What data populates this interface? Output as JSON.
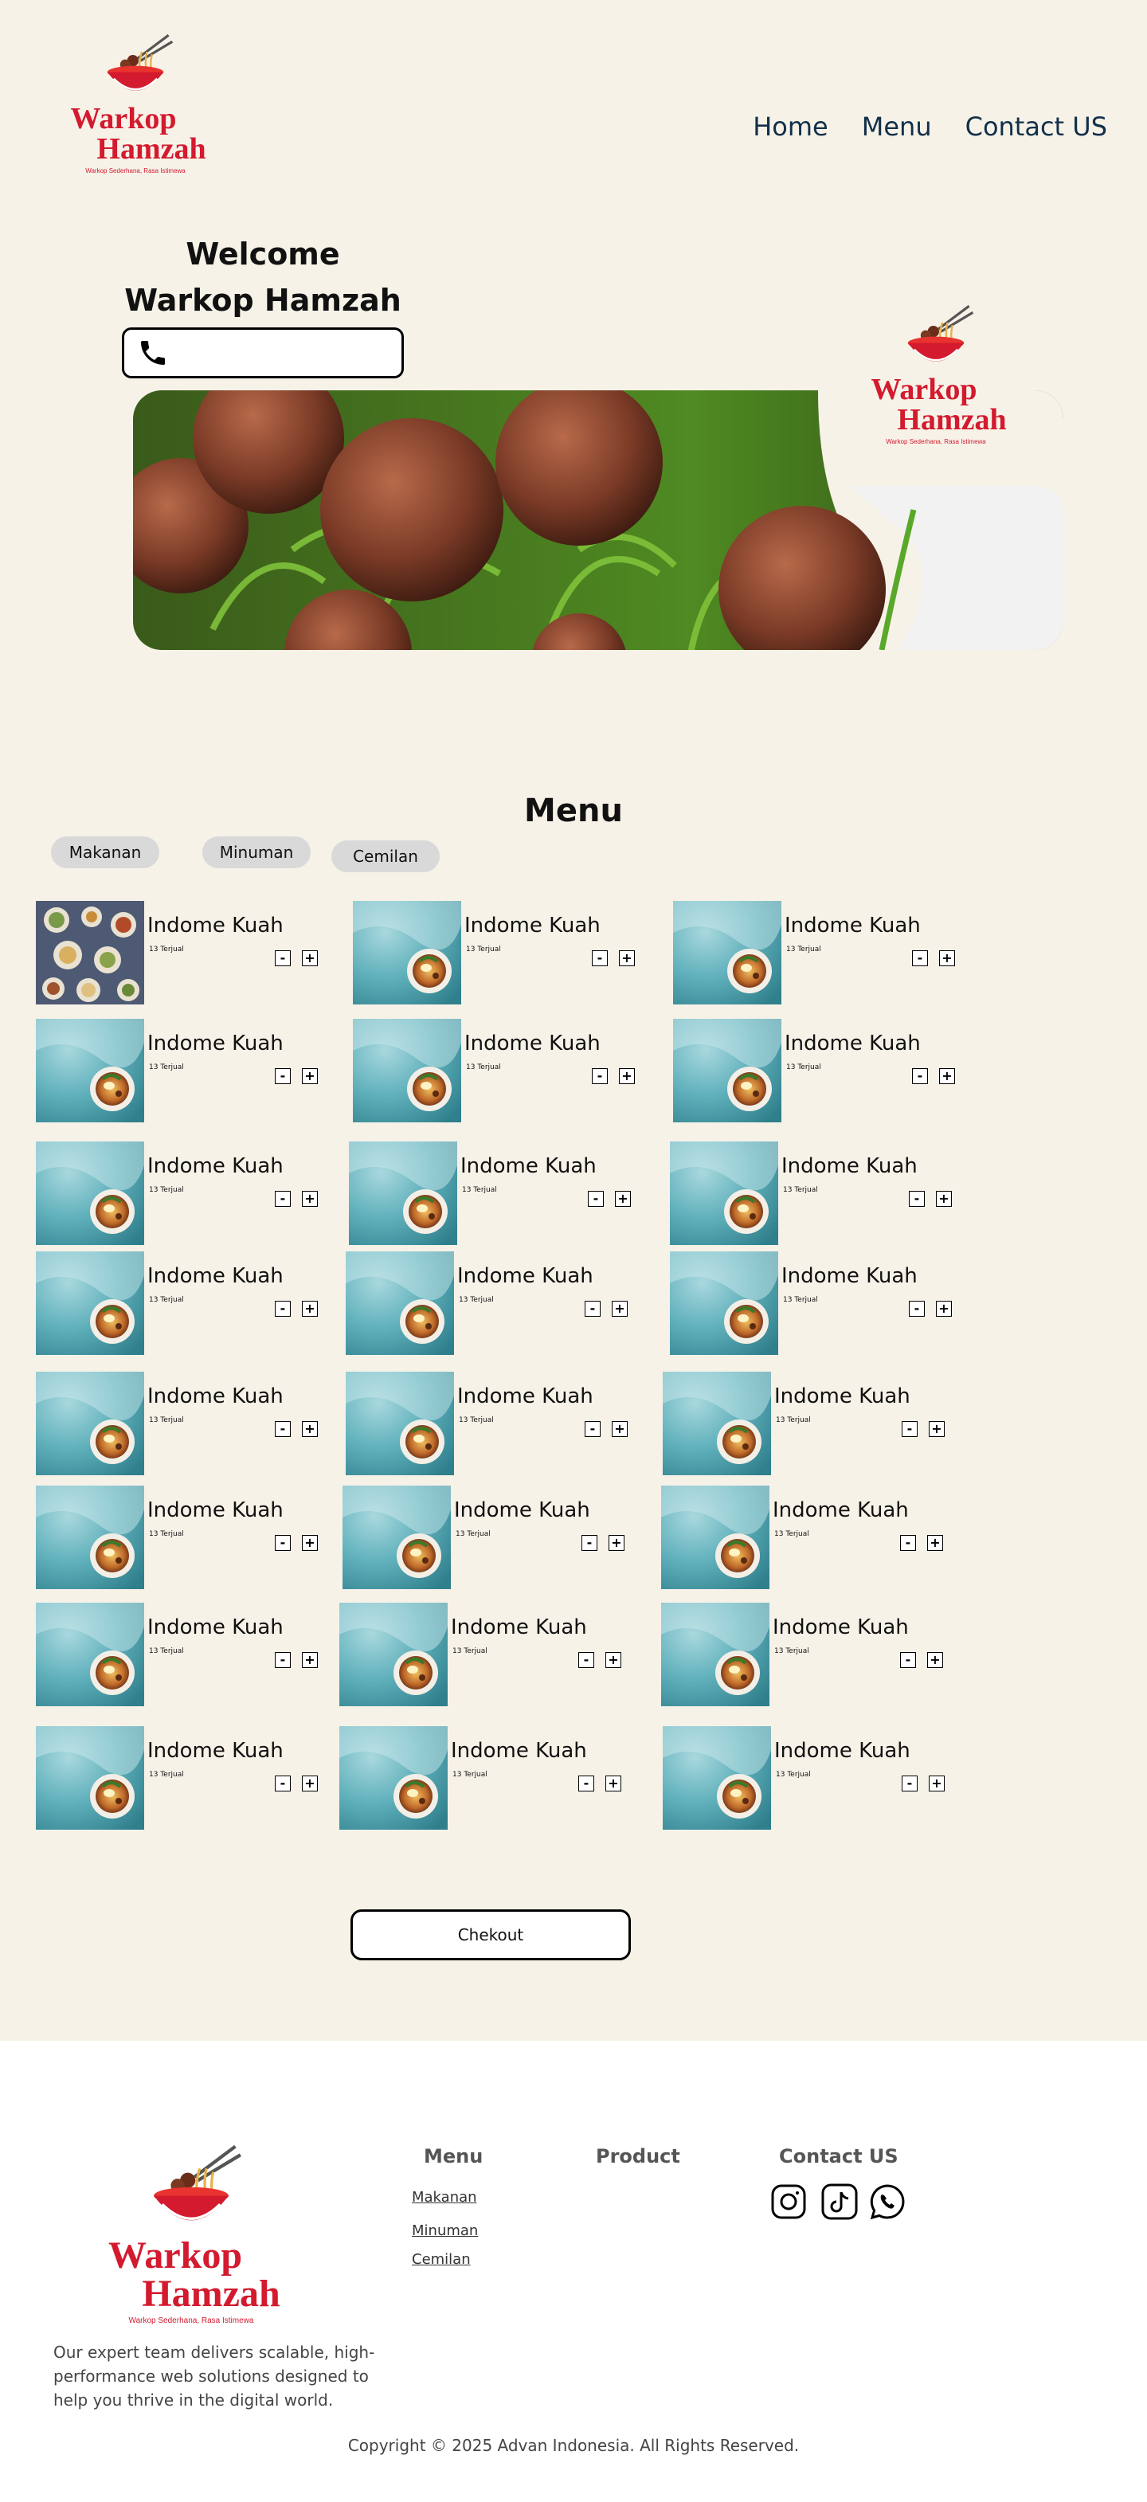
{
  "brand": {
    "name_line1": "Warkop",
    "name_line2": "Hamzah",
    "tagline": "Warkop Sederhana, Rasa Istimewa",
    "color": "#d31a2e"
  },
  "nav": {
    "home": "Home",
    "menu": "Menu",
    "contact": "Contact US"
  },
  "hero": {
    "welcome_line1": "Welcome",
    "welcome_line2": "Warkop Hamzah",
    "phone_icon": "phone-icon",
    "phone_value": ""
  },
  "menu": {
    "title": "Menu",
    "categories": [
      "Makanan",
      "Minuman",
      "Cemilan"
    ],
    "item_name": "Indome Kuah",
    "item_sold": "13 Terjual",
    "minus_label": "-",
    "plus_label": "+",
    "checkout_label": "Chekout"
  },
  "footer": {
    "description": "Our expert team delivers scalable, high-performance web solutions designed to help you thrive in the digital world.",
    "col_menu": "Menu",
    "col_product": "Product",
    "col_contact": "Contact US",
    "links": [
      "Makanan",
      "Minuman",
      "Cemilan"
    ],
    "social_icons": [
      "instagram-icon",
      "tiktok-icon",
      "whatsapp-icon"
    ],
    "copyright": "Copyright © 2025 Advan Indonesia. All Rights Reserved."
  }
}
